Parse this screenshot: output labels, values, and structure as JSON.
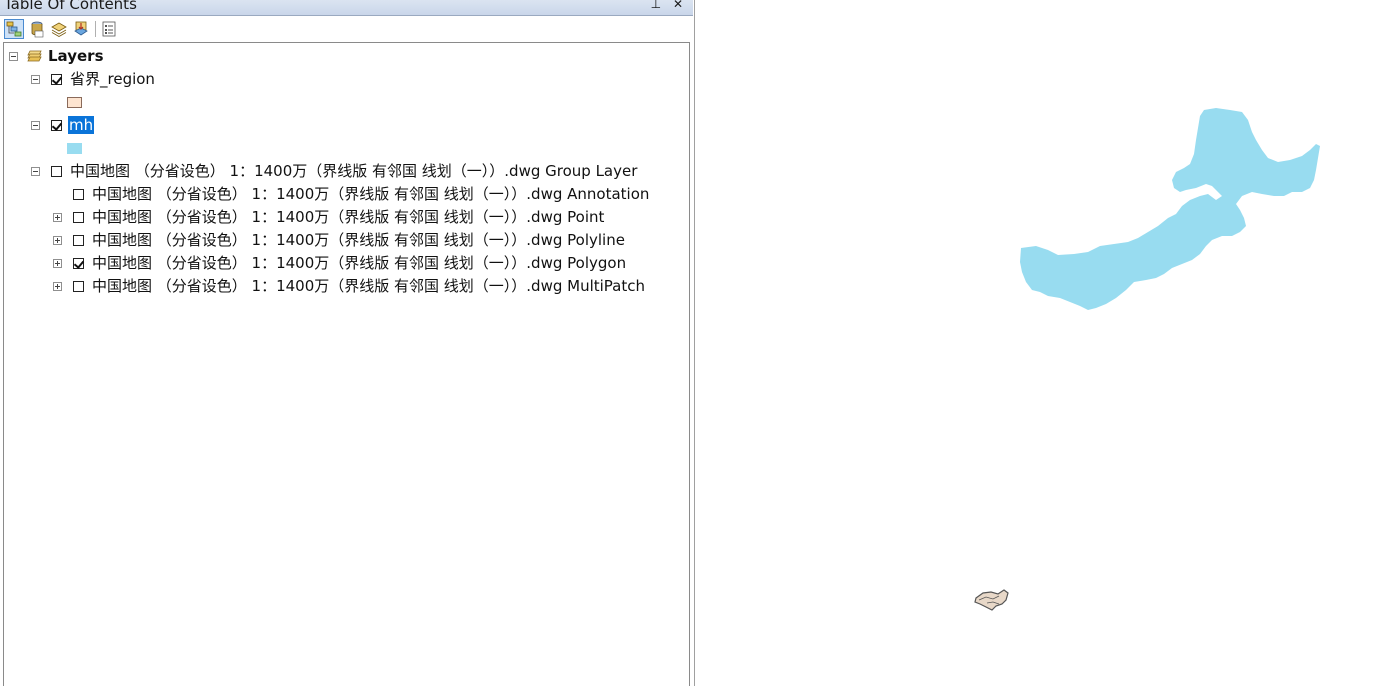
{
  "panel": {
    "title": "Table Of Contents",
    "pin_glyph": "⊥",
    "close_glyph": "✕"
  },
  "toolbar": {
    "buttons": [
      {
        "name": "list-by-drawing-order-icon",
        "active": true
      },
      {
        "name": "list-by-source-icon",
        "active": false
      },
      {
        "name": "list-by-visibility-icon",
        "active": false
      },
      {
        "name": "list-by-selection-icon",
        "active": false
      },
      {
        "name": "options-icon",
        "active": false
      }
    ]
  },
  "tree": {
    "root_label": "Layers",
    "layers": [
      {
        "label": "省界_region",
        "checked": true,
        "swatch_color": "#fde4d0",
        "swatch_border": "#8a6a5a"
      },
      {
        "label": "mh",
        "checked": true,
        "selected": true,
        "swatch_color": "#98dcf0",
        "swatch_border": "#98dcf0"
      }
    ],
    "group": {
      "label": "中国地图 （分省设色） 1：1400万（界线版 有邻国 线划（一））.dwg Group Layer",
      "checked": false,
      "children": [
        {
          "label": "中国地图 （分省设色） 1：1400万（界线版 有邻国 线划（一））.dwg Annotation",
          "checked": false,
          "expandable": false
        },
        {
          "label": "中国地图 （分省设色） 1：1400万（界线版 有邻国 线划（一））.dwg Point",
          "checked": false,
          "expandable": true
        },
        {
          "label": "中国地图 （分省设色） 1：1400万（界线版 有邻国 线划（一））.dwg Polyline",
          "checked": false,
          "expandable": true
        },
        {
          "label": "中国地图 （分省设色） 1：1400万（界线版 有邻国 线划（一））.dwg Polygon",
          "checked": true,
          "expandable": true
        },
        {
          "label": "中国地图 （分省设色） 1：1400万（界线版 有邻国 线划（一））.dwg MultiPatch",
          "checked": false,
          "expandable": true
        }
      ]
    }
  },
  "map": {
    "mh_fill": "#98dcf0",
    "small_feature_fill": "#e8d8c8",
    "small_feature_stroke": "#555555"
  }
}
